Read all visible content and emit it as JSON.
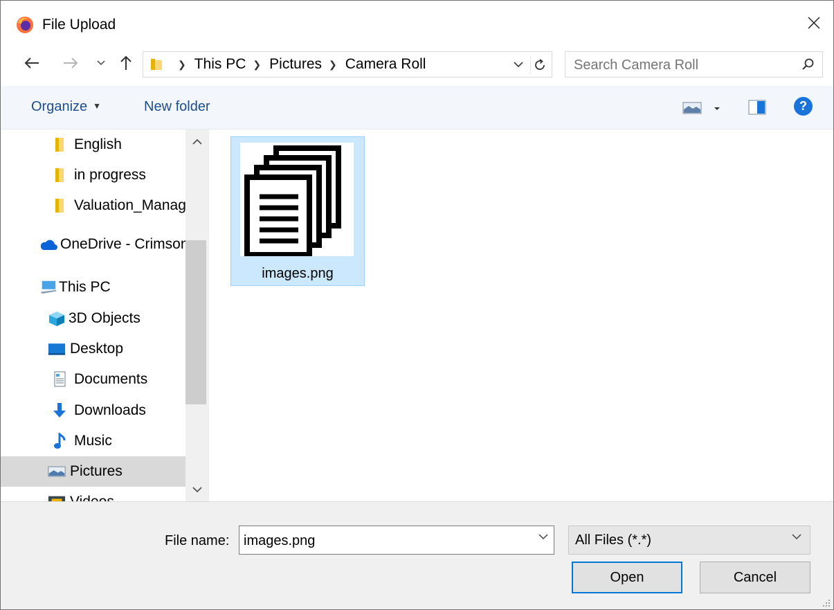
{
  "window": {
    "title": "File Upload"
  },
  "address": {
    "crumbs": [
      "This PC",
      "Pictures",
      "Camera Roll"
    ]
  },
  "search": {
    "placeholder": "Search Camera Roll"
  },
  "toolbar": {
    "organize_label": "Organize",
    "new_folder_label": "New folder",
    "help_label": "?"
  },
  "nav": {
    "items": [
      {
        "label": "English",
        "icon": "folder-icon"
      },
      {
        "label": "in progress",
        "icon": "folder-icon"
      },
      {
        "label": "Valuation_Management",
        "icon": "folder-icon"
      },
      {
        "label": "OneDrive - Crimson",
        "icon": "onedrive-cloud-icon"
      },
      {
        "label": "This PC",
        "icon": "computer-icon"
      },
      {
        "label": "3D Objects",
        "icon": "3d-objects-icon"
      },
      {
        "label": "Desktop",
        "icon": "desktop-icon"
      },
      {
        "label": "Documents",
        "icon": "documents-icon"
      },
      {
        "label": "Downloads",
        "icon": "downloads-arrow-icon"
      },
      {
        "label": "Music",
        "icon": "music-note-icon"
      },
      {
        "label": "Pictures",
        "icon": "pictures-icon"
      },
      {
        "label": "Videos",
        "icon": "videos-icon"
      }
    ],
    "selected": "Pictures"
  },
  "files": [
    {
      "name": "images.png",
      "icon": "documents-stack-icon",
      "selected": true
    }
  ],
  "footer": {
    "filename_label": "File name:",
    "filename_value": "images.png",
    "filter_value": "All Files (*.*)",
    "open_label": "Open",
    "cancel_label": "Cancel"
  },
  "colors": {
    "accent": "#0078d7",
    "selection": "#cce8ff",
    "nav_selected": "#d9d9d9",
    "toolbar_bg": "#f3f6fb"
  }
}
